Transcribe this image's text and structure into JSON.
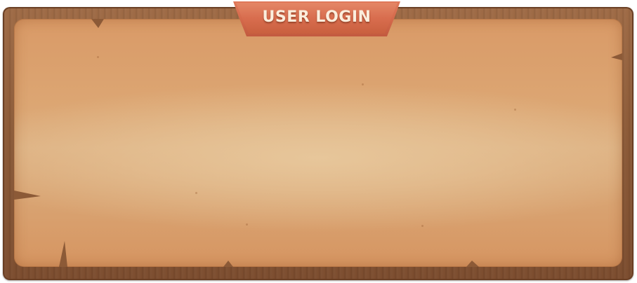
{
  "panel": {
    "title": "USER LOGIN"
  },
  "colors": {
    "wood": "#8c5a37",
    "parchment": "#dca673",
    "banner": "#d3684a",
    "title_text": "#fbeedd"
  }
}
